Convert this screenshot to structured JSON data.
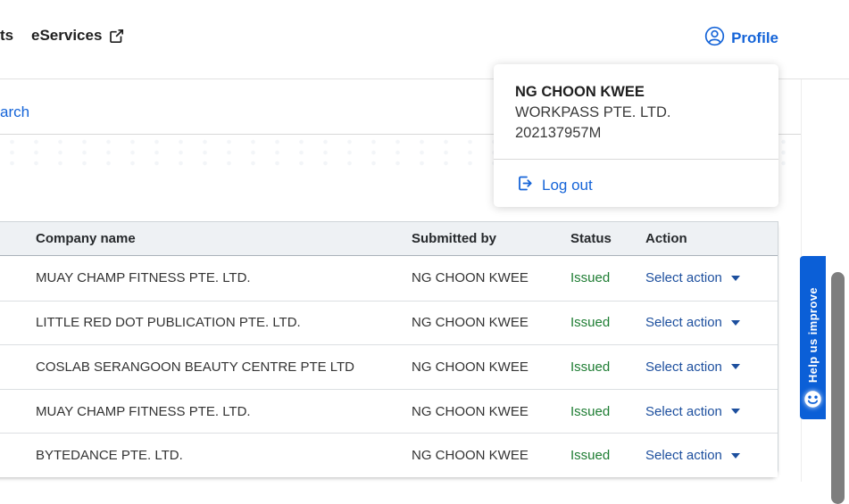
{
  "nav": {
    "clipped_item": "ts",
    "eservices_label": "eServices",
    "profile_label": "Profile"
  },
  "page": {
    "clipped_back_link": "arch"
  },
  "profile_menu": {
    "name": "NG CHOON KWEE",
    "company": "WORKPASS PTE. LTD.",
    "uen": "202137957M",
    "logout_label": "Log out"
  },
  "table": {
    "columns": [
      "Company name",
      "Submitted by",
      "Status",
      "Action"
    ],
    "action_label": "Select action",
    "rows": [
      {
        "company": "MUAY CHAMP FITNESS PTE. LTD.",
        "submitted_by": "NG CHOON KWEE",
        "status": "Issued",
        "action": "Select action"
      },
      {
        "company": "LITTLE RED DOT PUBLICATION PTE. LTD.",
        "submitted_by": "NG CHOON KWEE",
        "status": "Issued",
        "action": "Select action"
      },
      {
        "company": "COSLAB SERANGOON BEAUTY CENTRE PTE LTD",
        "submitted_by": "NG CHOON KWEE",
        "status": "Issued",
        "action": "Select action"
      },
      {
        "company": "MUAY CHAMP FITNESS PTE. LTD.",
        "submitted_by": "NG CHOON KWEE",
        "status": "Issued",
        "action": "Select action"
      },
      {
        "company": "BYTEDANCE PTE. LTD.",
        "submitted_by": "NG CHOON KWEE",
        "status": "Issued",
        "action": "Select action"
      }
    ]
  },
  "feedback_tab": {
    "label": "Help us improve",
    "icon": "smiley-icon"
  },
  "icons": {
    "profile": "user-circle-icon",
    "eservices": "external-link-icon",
    "logout": "logout-icon",
    "action_caret": "chevron-down-icon"
  },
  "colors": {
    "link_blue": "#1564d8",
    "action_blue": "#1d4f9e",
    "status_green": "#1e7d33",
    "feedback_blue": "#0b5fd7",
    "table_header_bg": "#eef1f4",
    "border_gray": "#cfd4d8"
  }
}
